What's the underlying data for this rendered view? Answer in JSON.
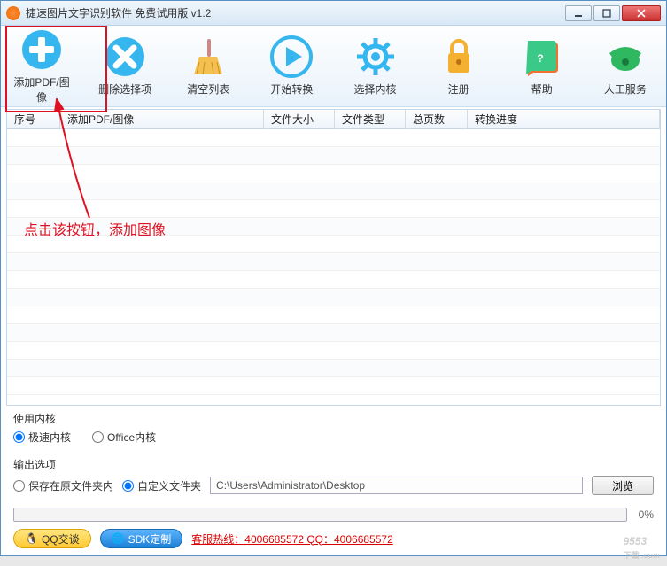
{
  "window": {
    "title": "捷速图片文字识别软件 免费试用版 v1.2"
  },
  "toolbar": {
    "add": "添加PDF/图像",
    "delete": "删除选择项",
    "clear": "清空列表",
    "start": "开始转换",
    "kernel": "选择内核",
    "register": "注册",
    "help": "帮助",
    "service": "人工服务"
  },
  "table": {
    "col_seq": "序号",
    "col_add": "添加PDF/图像",
    "col_size": "文件大小",
    "col_type": "文件类型",
    "col_pages": "总页数",
    "col_progress": "转换进度"
  },
  "annotation": "点击该按钮，添加图像",
  "kernel_panel": {
    "heading": "使用内核",
    "opt_fast": "极速内核",
    "opt_office": "Office内核"
  },
  "output_panel": {
    "heading": "输出选项",
    "opt_same": "保存在原文件夹内",
    "opt_custom": "自定义文件夹",
    "path": "C:\\Users\\Administrator\\Desktop",
    "browse": "浏览"
  },
  "progress": {
    "pct": "0%"
  },
  "footer": {
    "qq": "QQ交谈",
    "sdk": "SDK定制",
    "hotline": "客服热线：4006685572 QQ：4006685572"
  },
  "watermark": {
    "main": "9553",
    "sub": "下载 .com"
  }
}
